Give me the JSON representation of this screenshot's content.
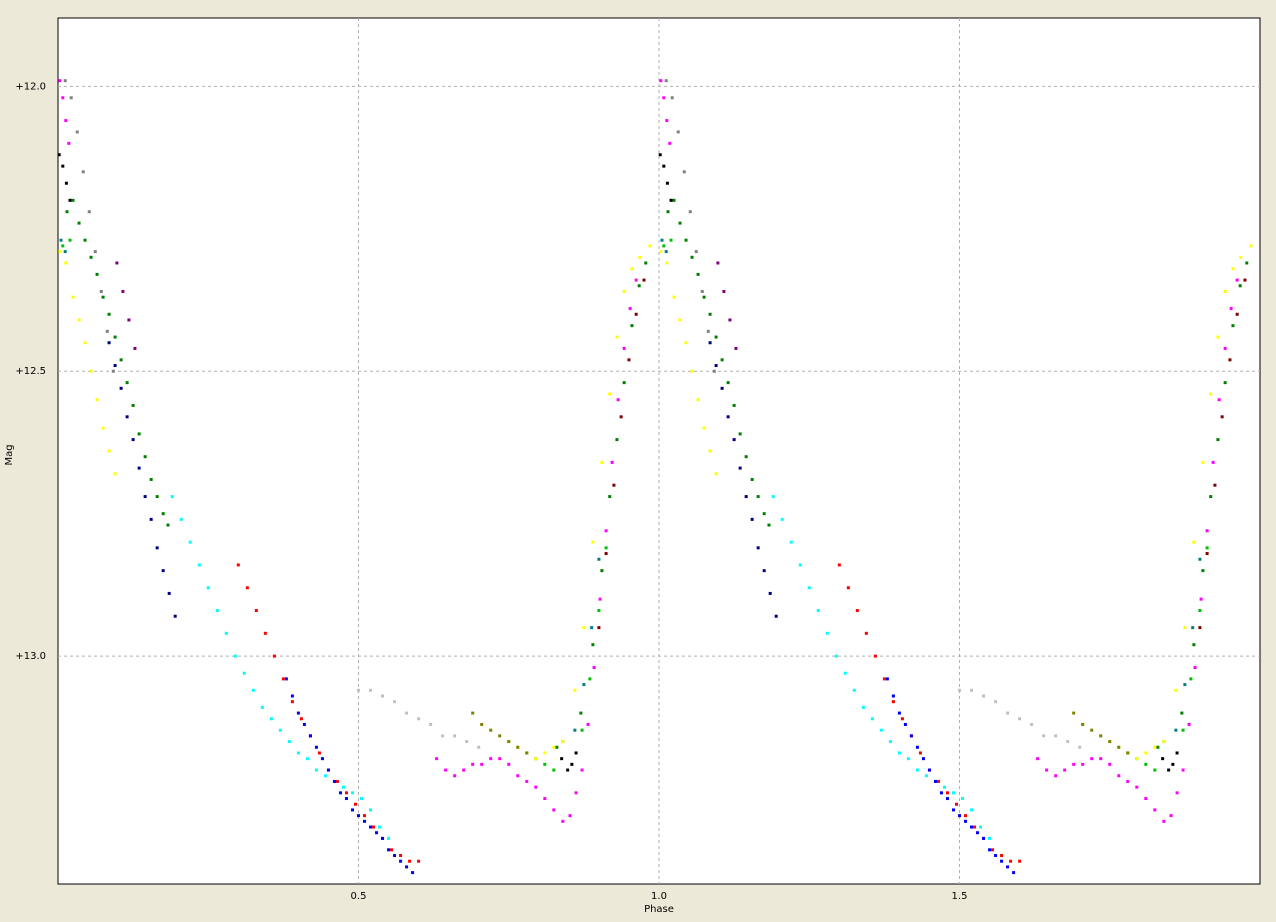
{
  "chart_data": {
    "type": "scatter",
    "title": "",
    "xlabel": "Phase",
    "ylabel": "Mag",
    "xlim": [
      0.0,
      2.0
    ],
    "ylim": [
      13.4,
      11.88
    ],
    "y_inverted": true,
    "x_ticks": [
      0.5,
      1.0,
      1.5
    ],
    "x_tick_labels": [
      "0.5",
      "1.0",
      "1.5"
    ],
    "y_ticks": [
      12.0,
      12.5,
      13.0
    ],
    "y_tick_labels": [
      "+12.0",
      "+12.5",
      "+13.0"
    ],
    "grid": true,
    "grid_style": "dashed",
    "legend": "none",
    "plot_background": "#ffffff",
    "frame_background": "#ece9d8",
    "phase_repeat": "data shown for phase 0–1 and repeated for phase 1–2",
    "series": [
      {
        "color": "#808080",
        "points": [
          [
            0.012,
            11.99
          ],
          [
            0.022,
            12.02
          ],
          [
            0.032,
            12.08
          ],
          [
            0.042,
            12.15
          ],
          [
            0.052,
            12.22
          ],
          [
            0.062,
            12.29
          ],
          [
            0.072,
            12.36
          ],
          [
            0.082,
            12.43
          ],
          [
            0.092,
            12.5
          ]
        ]
      },
      {
        "color": "#ff00ff",
        "points": [
          [
            0.003,
            11.99
          ],
          [
            0.008,
            12.02
          ],
          [
            0.013,
            12.06
          ],
          [
            0.018,
            12.1
          ]
        ]
      },
      {
        "color": "#000000",
        "points": [
          [
            0.002,
            12.12
          ],
          [
            0.008,
            12.14
          ],
          [
            0.014,
            12.17
          ],
          [
            0.02,
            12.2
          ],
          [
            0.838,
            13.18
          ],
          [
            0.848,
            13.2
          ],
          [
            0.855,
            13.19
          ],
          [
            0.862,
            13.17
          ]
        ]
      },
      {
        "color": "#800080",
        "points": [
          [
            0.098,
            12.31
          ],
          [
            0.108,
            12.36
          ],
          [
            0.118,
            12.41
          ],
          [
            0.128,
            12.46
          ]
        ]
      },
      {
        "color": "#008000",
        "points": [
          [
            0.015,
            12.22
          ],
          [
            0.025,
            12.2
          ],
          [
            0.035,
            12.24
          ],
          [
            0.045,
            12.27
          ],
          [
            0.055,
            12.3
          ],
          [
            0.065,
            12.33
          ],
          [
            0.075,
            12.37
          ],
          [
            0.085,
            12.4
          ],
          [
            0.095,
            12.44
          ],
          [
            0.105,
            12.48
          ],
          [
            0.115,
            12.52
          ],
          [
            0.125,
            12.56
          ],
          [
            0.135,
            12.61
          ],
          [
            0.145,
            12.65
          ],
          [
            0.155,
            12.69
          ],
          [
            0.165,
            12.72
          ],
          [
            0.175,
            12.75
          ],
          [
            0.183,
            12.77
          ],
          [
            0.83,
            13.16
          ],
          [
            0.84,
            13.15
          ],
          [
            0.87,
            13.1
          ],
          [
            0.89,
            12.98
          ],
          [
            0.905,
            12.85
          ],
          [
            0.918,
            12.72
          ],
          [
            0.93,
            12.62
          ],
          [
            0.942,
            12.52
          ],
          [
            0.955,
            12.42
          ],
          [
            0.967,
            12.35
          ],
          [
            0.978,
            12.31
          ]
        ]
      },
      {
        "color": "#00c000",
        "points": [
          [
            0.008,
            12.28
          ],
          [
            0.02,
            12.27
          ],
          [
            0.78,
            13.17
          ],
          [
            0.795,
            13.18
          ],
          [
            0.81,
            13.19
          ],
          [
            0.825,
            13.2
          ],
          [
            0.872,
            13.13
          ],
          [
            0.885,
            13.04
          ],
          [
            0.9,
            12.92
          ],
          [
            0.912,
            12.81
          ]
        ]
      },
      {
        "color": "#008080",
        "points": [
          [
            0.005,
            12.27
          ],
          [
            0.012,
            12.29
          ],
          [
            0.86,
            13.13
          ],
          [
            0.875,
            13.05
          ],
          [
            0.888,
            12.95
          ],
          [
            0.9,
            12.83
          ]
        ]
      },
      {
        "color": "#ffff00",
        "points": [
          [
            0.003,
            12.29
          ],
          [
            0.013,
            12.31
          ],
          [
            0.025,
            12.37
          ],
          [
            0.035,
            12.41
          ],
          [
            0.045,
            12.45
          ],
          [
            0.055,
            12.5
          ],
          [
            0.065,
            12.55
          ],
          [
            0.075,
            12.6
          ],
          [
            0.085,
            12.64
          ],
          [
            0.095,
            12.68
          ],
          [
            0.75,
            13.15
          ],
          [
            0.765,
            13.16
          ],
          [
            0.78,
            13.17
          ],
          [
            0.795,
            13.18
          ],
          [
            0.81,
            13.17
          ],
          [
            0.825,
            13.16
          ],
          [
            0.84,
            13.15
          ],
          [
            0.86,
            13.06
          ],
          [
            0.875,
            12.95
          ],
          [
            0.89,
            12.8
          ],
          [
            0.905,
            12.66
          ],
          [
            0.918,
            12.54
          ],
          [
            0.93,
            12.44
          ],
          [
            0.942,
            12.36
          ],
          [
            0.955,
            12.32
          ],
          [
            0.968,
            12.3
          ],
          [
            0.985,
            12.28
          ]
        ]
      },
      {
        "color": "#000080",
        "points": [
          [
            0.085,
            12.45
          ],
          [
            0.095,
            12.49
          ],
          [
            0.105,
            12.53
          ],
          [
            0.115,
            12.58
          ],
          [
            0.125,
            12.62
          ],
          [
            0.135,
            12.67
          ],
          [
            0.145,
            12.72
          ],
          [
            0.155,
            12.76
          ],
          [
            0.165,
            12.81
          ],
          [
            0.175,
            12.85
          ],
          [
            0.185,
            12.89
          ],
          [
            0.195,
            12.93
          ]
        ]
      },
      {
        "color": "#00ffff",
        "points": [
          [
            0.19,
            12.72
          ],
          [
            0.205,
            12.76
          ],
          [
            0.22,
            12.8
          ],
          [
            0.235,
            12.84
          ],
          [
            0.25,
            12.88
          ],
          [
            0.265,
            12.92
          ],
          [
            0.28,
            12.96
          ],
          [
            0.295,
            13.0
          ],
          [
            0.31,
            13.03
          ],
          [
            0.325,
            13.06
          ],
          [
            0.34,
            13.09
          ],
          [
            0.355,
            13.11
          ],
          [
            0.37,
            13.13
          ],
          [
            0.385,
            13.15
          ],
          [
            0.4,
            13.17
          ],
          [
            0.415,
            13.18
          ],
          [
            0.43,
            13.2
          ],
          [
            0.445,
            13.21
          ],
          [
            0.46,
            13.22
          ],
          [
            0.475,
            13.23
          ],
          [
            0.49,
            13.24
          ],
          [
            0.505,
            13.25
          ],
          [
            0.52,
            13.27
          ],
          [
            0.535,
            13.3
          ],
          [
            0.55,
            13.32
          ]
        ]
      },
      {
        "color": "#ff0000",
        "points": [
          [
            0.3,
            12.84
          ],
          [
            0.315,
            12.88
          ],
          [
            0.33,
            12.92
          ],
          [
            0.345,
            12.96
          ],
          [
            0.36,
            13.0
          ],
          [
            0.375,
            13.04
          ],
          [
            0.39,
            13.08
          ],
          [
            0.405,
            13.11
          ],
          [
            0.42,
            13.14
          ],
          [
            0.435,
            13.17
          ],
          [
            0.45,
            13.2
          ],
          [
            0.465,
            13.22
          ],
          [
            0.48,
            13.24
          ],
          [
            0.495,
            13.26
          ],
          [
            0.51,
            13.28
          ],
          [
            0.525,
            13.3
          ],
          [
            0.54,
            13.32
          ],
          [
            0.555,
            13.34
          ],
          [
            0.57,
            13.35
          ],
          [
            0.585,
            13.36
          ],
          [
            0.6,
            13.36
          ]
        ]
      },
      {
        "color": "#0000ff",
        "points": [
          [
            0.38,
            13.04
          ],
          [
            0.39,
            13.07
          ],
          [
            0.4,
            13.1
          ],
          [
            0.41,
            13.12
          ],
          [
            0.42,
            13.14
          ],
          [
            0.43,
            13.16
          ],
          [
            0.44,
            13.18
          ],
          [
            0.45,
            13.2
          ],
          [
            0.46,
            13.22
          ],
          [
            0.47,
            13.24
          ],
          [
            0.48,
            13.25
          ],
          [
            0.49,
            13.27
          ],
          [
            0.5,
            13.28
          ],
          [
            0.51,
            13.29
          ],
          [
            0.52,
            13.3
          ],
          [
            0.53,
            13.31
          ],
          [
            0.54,
            13.32
          ],
          [
            0.55,
            13.34
          ],
          [
            0.56,
            13.35
          ],
          [
            0.57,
            13.36
          ],
          [
            0.58,
            13.37
          ],
          [
            0.59,
            13.38
          ]
        ]
      },
      {
        "color": "#c0c0c0",
        "points": [
          [
            0.5,
            13.06
          ],
          [
            0.52,
            13.06
          ],
          [
            0.54,
            13.07
          ],
          [
            0.56,
            13.08
          ],
          [
            0.58,
            13.1
          ],
          [
            0.6,
            13.11
          ],
          [
            0.62,
            13.12
          ],
          [
            0.64,
            13.14
          ],
          [
            0.66,
            13.14
          ],
          [
            0.68,
            13.15
          ],
          [
            0.7,
            13.16
          ]
        ]
      },
      {
        "color": "#ff00ff",
        "points": [
          [
            0.63,
            13.18
          ],
          [
            0.645,
            13.2
          ],
          [
            0.66,
            13.21
          ],
          [
            0.675,
            13.2
          ],
          [
            0.69,
            13.19
          ],
          [
            0.705,
            13.19
          ],
          [
            0.72,
            13.18
          ],
          [
            0.735,
            13.18
          ],
          [
            0.75,
            13.19
          ],
          [
            0.765,
            13.21
          ],
          [
            0.78,
            13.22
          ],
          [
            0.795,
            13.23
          ],
          [
            0.81,
            13.25
          ],
          [
            0.825,
            13.27
          ],
          [
            0.84,
            13.29
          ],
          [
            0.852,
            13.28
          ],
          [
            0.862,
            13.24
          ],
          [
            0.872,
            13.2
          ],
          [
            0.882,
            13.12
          ],
          [
            0.892,
            13.02
          ],
          [
            0.902,
            12.9
          ],
          [
            0.912,
            12.78
          ],
          [
            0.922,
            12.66
          ],
          [
            0.932,
            12.55
          ],
          [
            0.942,
            12.46
          ],
          [
            0.952,
            12.39
          ],
          [
            0.962,
            12.34
          ]
        ]
      },
      {
        "color": "#808000",
        "points": [
          [
            0.69,
            13.1
          ],
          [
            0.705,
            13.12
          ],
          [
            0.72,
            13.13
          ],
          [
            0.735,
            13.14
          ],
          [
            0.75,
            13.15
          ],
          [
            0.765,
            13.16
          ],
          [
            0.78,
            13.17
          ]
        ]
      },
      {
        "color": "#800000",
        "points": [
          [
            0.9,
            12.95
          ],
          [
            0.912,
            12.82
          ],
          [
            0.925,
            12.7
          ],
          [
            0.937,
            12.58
          ],
          [
            0.95,
            12.48
          ],
          [
            0.962,
            12.4
          ],
          [
            0.975,
            12.34
          ]
        ]
      }
    ]
  }
}
